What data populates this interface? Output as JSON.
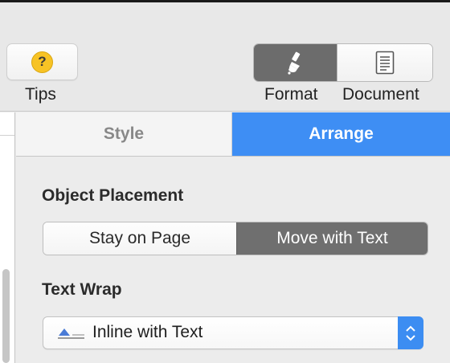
{
  "toolbar": {
    "tips_label": "Tips",
    "tips_icon": "question-circle-icon",
    "format_label": "Format",
    "format_icon": "paintbrush-icon",
    "document_label": "Document",
    "document_icon": "document-icon",
    "active_view": "Format"
  },
  "inspector": {
    "tabs": [
      {
        "label": "Style",
        "selected": false
      },
      {
        "label": "Arrange",
        "selected": true
      }
    ],
    "object_placement": {
      "title": "Object Placement",
      "options": [
        "Stay on Page",
        "Move with Text"
      ],
      "selected": "Move with Text"
    },
    "text_wrap": {
      "title": "Text Wrap",
      "value": "Inline with Text",
      "icon": "inline-wrap-icon"
    }
  },
  "colors": {
    "accent": "#3e8ef4",
    "selected_segment": "#6f6f6f",
    "help_icon": "#f7c325"
  }
}
